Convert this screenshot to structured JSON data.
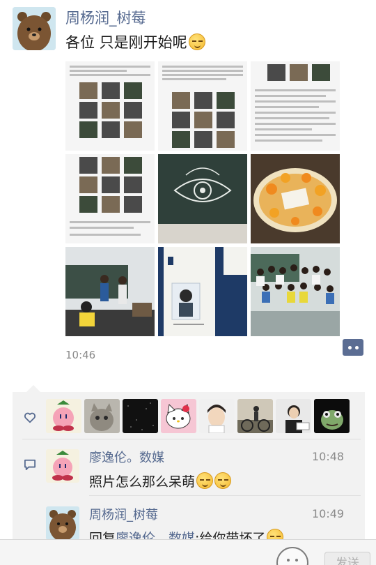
{
  "post": {
    "author": "周杨润_树莓",
    "text": "各位 只是刚开始呢",
    "emoji": "smirk-emoji",
    "time": "10:46",
    "photos": [
      {
        "name": "photo-screenshot-1"
      },
      {
        "name": "photo-screenshot-2"
      },
      {
        "name": "photo-screenshot-3"
      },
      {
        "name": "photo-screenshot-4"
      },
      {
        "name": "photo-blackboard-drawing"
      },
      {
        "name": "photo-fruit-cake"
      },
      {
        "name": "photo-classroom"
      },
      {
        "name": "photo-id-card"
      },
      {
        "name": "photo-group"
      }
    ]
  },
  "likes": {
    "icon": "heart-icon",
    "avatars": [
      "avatar-kirby",
      "avatar-cat",
      "avatar-dark",
      "avatar-hello-kitty",
      "avatar-boy",
      "avatar-cyclist",
      "avatar-person",
      "avatar-frog"
    ]
  },
  "comments": [
    {
      "author": "廖逸伦。数媒",
      "time": "10:48",
      "text": "照片怎么那么呆萌"
    },
    {
      "author": "周杨润_树莓",
      "time": "10:49",
      "reply_prefix": "回复",
      "reply_to": "廖逸伦。数媒",
      "text": ":给你带坏了"
    }
  ],
  "input": {
    "send_label": "发送"
  },
  "colors": {
    "name_link": "#55698f",
    "panel_bg": "#f2f2f2",
    "more_button": "#5b6d93"
  }
}
